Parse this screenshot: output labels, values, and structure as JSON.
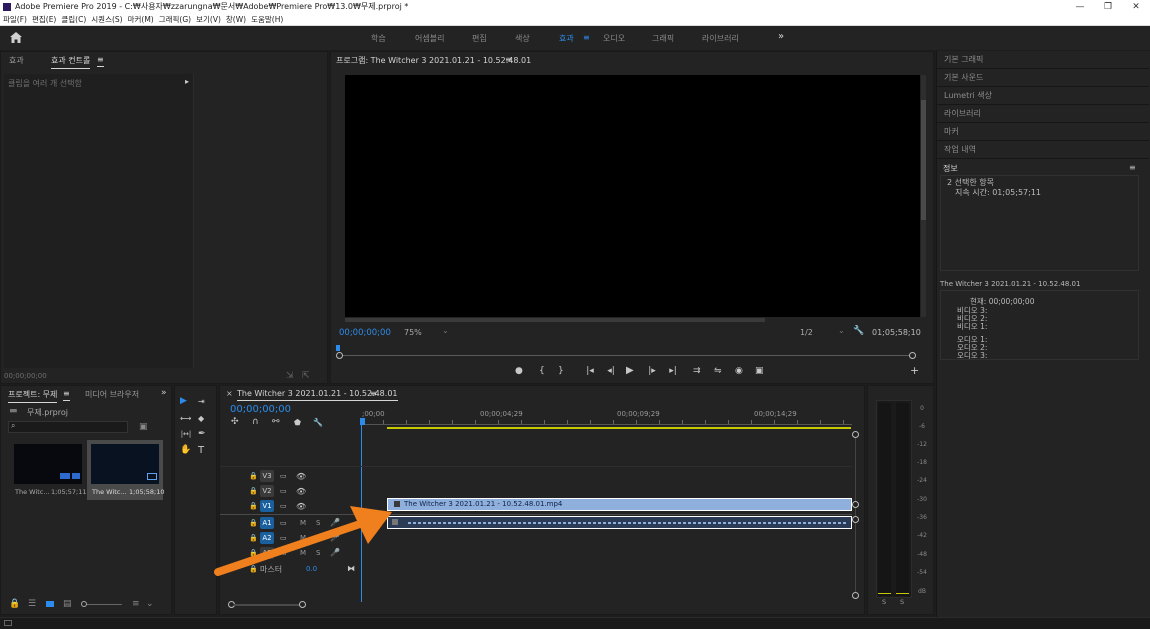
{
  "titlebar": {
    "title": "Adobe Premiere Pro 2019 - C:₩사용자₩zzarungna₩문서₩Adobe₩Premiere Pro₩13.0₩무제.prproj *",
    "minimize": "—",
    "restore": "❐",
    "close": "✕"
  },
  "menu": [
    "파일(F)",
    "편집(E)",
    "클립(C)",
    "시퀀스(S)",
    "마커(M)",
    "그래픽(G)",
    "보기(V)",
    "창(W)",
    "도움말(H)"
  ],
  "workspaces": [
    "학습",
    "어셈블리",
    "편집",
    "색상",
    "효과",
    "오디오",
    "그래픽",
    "라이브러리"
  ],
  "workspace_active_menu": "≡",
  "workspace_more": "»",
  "effect_controls": {
    "tab_effects": "효과",
    "tab_controls": "효과 컨트롤",
    "menu": "≡",
    "message": "클립을 여러 개 선택함",
    "play_arrow": "▸",
    "timecode": "00;00;00;00"
  },
  "program": {
    "title": "프로그램: The Witcher 3 2021.01.21 - 10.52.48.01",
    "menu": "≡",
    "timecode": "00;00;00;00",
    "zoom": "75%",
    "resolution": "1/2",
    "duration": "01;05;58;10"
  },
  "transport": {
    "marker": "●",
    "in": "{",
    "out": "}",
    "go_in": "|◂",
    "step_back": "◂|",
    "play": "▶",
    "step_fwd": "|▸",
    "go_out": "▸|",
    "insert": "⇉",
    "overwrite": "⇋",
    "export": "◉",
    "compare": "▣",
    "add": "+"
  },
  "right_list": [
    "기본 그래픽",
    "기본 사운드",
    "Lumetri 색상",
    "라이브러리",
    "마커",
    "작업 내역"
  ],
  "info": {
    "title": "정보",
    "menu": "≡",
    "selected": "2 선택한 항목",
    "duration": "지속 시간: 01;05;57;11",
    "seq_name": "The Witcher 3 2021.01.21 - 10.52.48.01",
    "current": "현재: 00;00;00;00",
    "video3": "비디오 3:",
    "video2": "비디오 2:",
    "video1": "비디오 1:",
    "audio1": "오디오 1:",
    "audio2": "오디오 2:",
    "audio3": "오디오 3:"
  },
  "project": {
    "tab": "프로젝트: 무제",
    "media_tab": "미디어 브라우저",
    "menu": "≡",
    "more": "»",
    "filename": "무제.prproj",
    "search_placeholder": "",
    "items": [
      {
        "name": "The Witc...",
        "duration": "1;05;57;11"
      },
      {
        "name": "The Witc...",
        "duration": "1;05;58;10"
      }
    ]
  },
  "tools": [
    "▶",
    "⇥",
    "⟷",
    "◆",
    "|↔|",
    "✒",
    "✋",
    "T"
  ],
  "timeline": {
    "close": "×",
    "title": "The Witcher 3 2021.01.21 - 10.52.48.01",
    "menu": "≡",
    "timecode": "00;00;00;00",
    "ruler": [
      ";00;00",
      "00;00;04;29",
      "00;00;09;29",
      "00;00;14;29"
    ],
    "tracks": [
      {
        "name": "V3",
        "type": "video"
      },
      {
        "name": "V2",
        "type": "video"
      },
      {
        "name": "V1",
        "type": "video",
        "active": true
      },
      {
        "name": "A1",
        "type": "audio",
        "active": true
      },
      {
        "name": "A2",
        "type": "audio",
        "active": true
      },
      {
        "name": "A3",
        "type": "audio"
      }
    ],
    "master_label": "마스터",
    "master_value": "0.0",
    "video_clip": "The Witcher 3 2021.01.21 - 10.52.48.01.mp4",
    "mute": "M",
    "solo": "S"
  },
  "meter": {
    "labels": [
      "0",
      "-6",
      "-12",
      "-18",
      "-24",
      "-30",
      "-36",
      "-42",
      "-48",
      "-54",
      "dB"
    ],
    "solo_left": "S",
    "solo_right": "S"
  },
  "colors": {
    "accent": "#2d8ceb",
    "clip_video": "#8fb0dc",
    "arrow": "#f07f1e",
    "timeline_yellow": "#c8c800"
  }
}
